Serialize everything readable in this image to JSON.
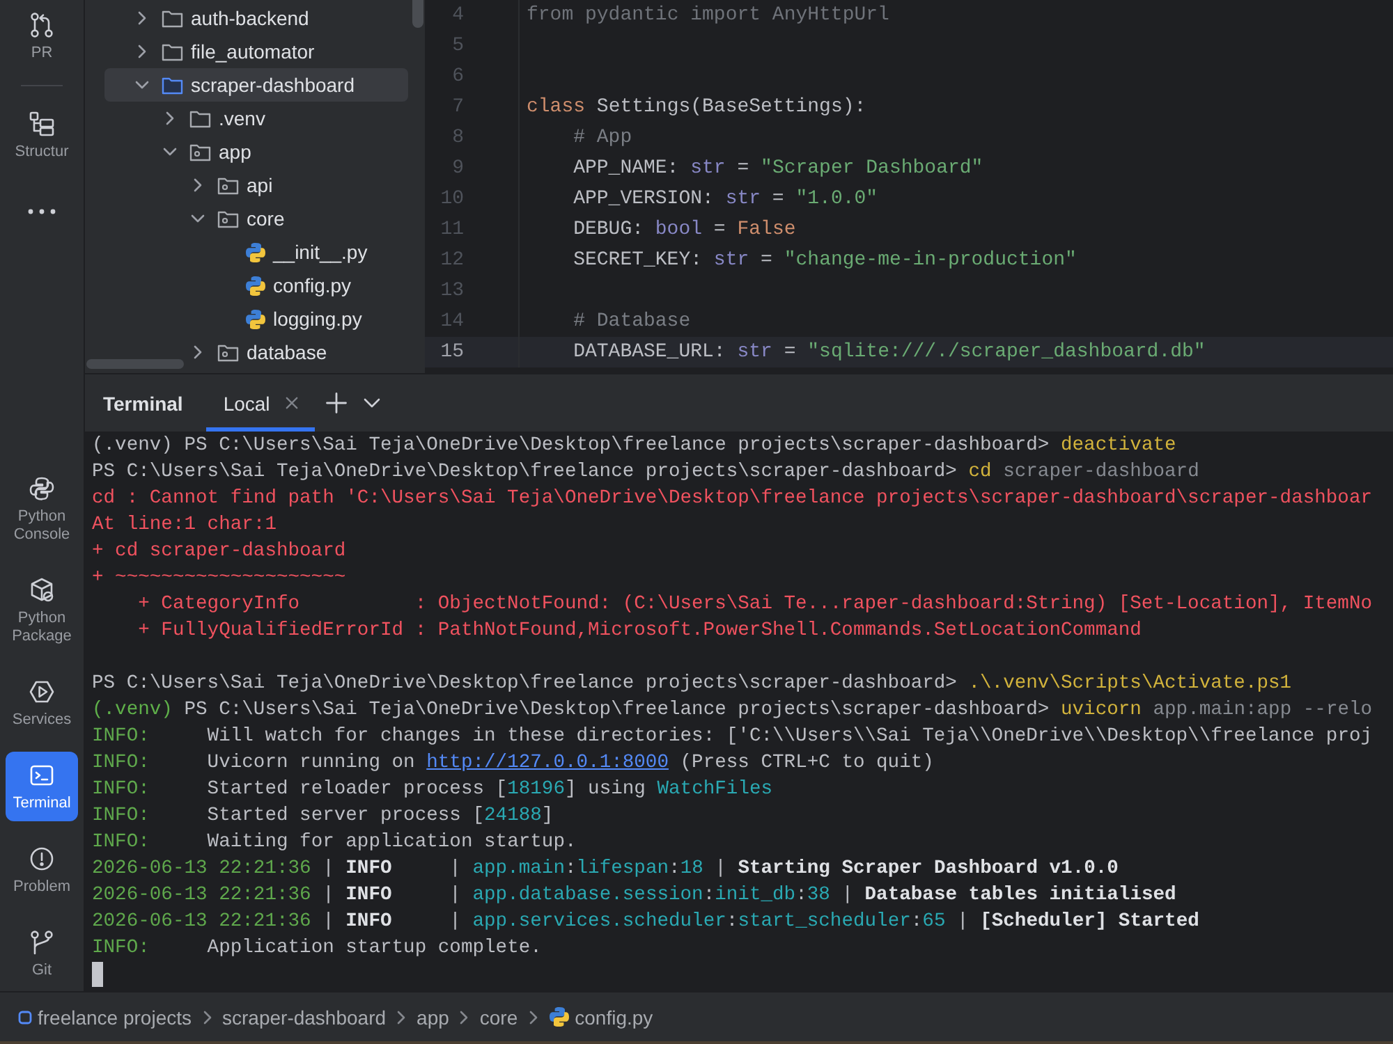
{
  "tool_strip": {
    "top": [
      {
        "kind": "pull-requests",
        "label": "PR",
        "selected": false
      },
      {
        "kind": "structure",
        "label": "Structur",
        "selected": false
      },
      {
        "kind": "more",
        "selected": false
      }
    ],
    "bottom": [
      {
        "kind": "python-console",
        "label": "Python Console",
        "selected": false
      },
      {
        "kind": "python-packages",
        "label": "Python Package",
        "selected": false
      },
      {
        "kind": "services",
        "label": "Services",
        "selected": false
      },
      {
        "kind": "terminal",
        "label": "Terminal",
        "selected": true
      },
      {
        "kind": "problems",
        "label": "Problem",
        "selected": false
      },
      {
        "kind": "git",
        "label": "Git",
        "selected": false
      }
    ]
  },
  "project_tree": {
    "items": [
      {
        "name": "auth-backend",
        "kind": "folder",
        "expanded": false,
        "selected": false
      },
      {
        "name": "file_automator",
        "kind": "folder",
        "expanded": false,
        "selected": false
      },
      {
        "name": "scraper-dashboard",
        "kind": "folder",
        "expanded": true,
        "selected": true,
        "children": [
          {
            "name": ".venv",
            "kind": "folder",
            "expanded": false,
            "selected": false
          },
          {
            "name": "app",
            "kind": "package",
            "expanded": true,
            "selected": false,
            "children": [
              {
                "name": "api",
                "kind": "package",
                "expanded": false,
                "selected": false
              },
              {
                "name": "core",
                "kind": "package",
                "expanded": true,
                "selected": false,
                "children": [
                  {
                    "name": "__init__.py",
                    "kind": "python-file",
                    "selected": false
                  },
                  {
                    "name": "config.py",
                    "kind": "python-file",
                    "selected": false
                  },
                  {
                    "name": "logging.py",
                    "kind": "python-file",
                    "selected": false
                  }
                ]
              },
              {
                "name": "database",
                "kind": "package",
                "expanded": false,
                "selected": false
              }
            ]
          }
        ]
      }
    ]
  },
  "editor": {
    "lines": [
      {
        "number": "4",
        "current": false,
        "tokens": [
          {
            "text": "from pydantic import AnyHttpUrl",
            "kind": "unused"
          }
        ]
      },
      {
        "number": "5",
        "current": false
      },
      {
        "number": "6",
        "current": false
      },
      {
        "number": "7",
        "current": false,
        "tokens": [
          {
            "text": "class",
            "kind": "keyword"
          },
          {
            "text": " Settings(BaseSettings):",
            "kind": "plain"
          }
        ],
        "children": [
          {
            "number": "8",
            "current": false,
            "tokens": [
              {
                "text": "# App",
                "kind": "comment"
              }
            ]
          },
          {
            "number": "9",
            "current": false,
            "tokens": [
              {
                "text": "APP_NAME: ",
                "kind": "plain"
              },
              {
                "text": "str",
                "kind": "builtin"
              },
              {
                "text": " = ",
                "kind": "plain"
              },
              {
                "text": "\"Scraper Dashboard\"",
                "kind": "string"
              }
            ]
          },
          {
            "number": "10",
            "current": false,
            "tokens": [
              {
                "text": "APP_VERSION: ",
                "kind": "plain"
              },
              {
                "text": "str",
                "kind": "builtin"
              },
              {
                "text": " = ",
                "kind": "plain"
              },
              {
                "text": "\"1.0.0\"",
                "kind": "string"
              }
            ]
          },
          {
            "number": "11",
            "current": false,
            "tokens": [
              {
                "text": "DEBUG: ",
                "kind": "plain"
              },
              {
                "text": "bool",
                "kind": "builtin"
              },
              {
                "text": " = ",
                "kind": "plain"
              },
              {
                "text": "False",
                "kind": "keyword"
              }
            ]
          },
          {
            "number": "12",
            "current": false,
            "tokens": [
              {
                "text": "SECRET_KEY: ",
                "kind": "plain"
              },
              {
                "text": "str",
                "kind": "builtin"
              },
              {
                "text": " = ",
                "kind": "plain"
              },
              {
                "text": "\"change-me-in-production\"",
                "kind": "string"
              }
            ]
          },
          {
            "number": "13",
            "current": false
          },
          {
            "number": "14",
            "current": false,
            "tokens": [
              {
                "text": "# Database",
                "kind": "comment"
              }
            ]
          },
          {
            "number": "15",
            "current": true,
            "tokens": [
              {
                "text": "DATABASE_URL: ",
                "kind": "plain"
              },
              {
                "text": "str",
                "kind": "builtin"
              },
              {
                "text": " = ",
                "kind": "plain"
              },
              {
                "text": "\"sqlite:///./scraper_dashboard.db\"",
                "kind": "string"
              }
            ]
          }
        ]
      }
    ]
  },
  "terminal": {
    "title": "Terminal",
    "tabs": [
      {
        "label": "Local",
        "selected": true
      }
    ],
    "cursor": true,
    "lines": [
      {
        "kind": "text",
        "segments": [
          {
            "text": "(.venv) PS C:\\Users\\Sai Teja\\OneDrive\\Desktop\\freelance projects\\scraper-dashboard> ",
            "kind": "plain"
          },
          {
            "text": "deactivate",
            "kind": "command"
          }
        ]
      },
      {
        "kind": "text",
        "segments": [
          {
            "text": "PS C:\\Users\\Sai Teja\\OneDrive\\Desktop\\freelance projects\\scraper-dashboard> ",
            "kind": "plain"
          },
          {
            "text": "cd",
            "kind": "command"
          },
          {
            "text": " scraper-dashboard",
            "kind": "arg"
          }
        ]
      },
      {
        "kind": "text",
        "segments": [
          {
            "text": "cd : Cannot find path 'C:\\Users\\Sai Teja\\OneDrive\\Desktop\\freelance projects\\scraper-dashboard\\scraper-dashboar",
            "kind": "error"
          }
        ]
      },
      {
        "kind": "text",
        "segments": [
          {
            "text": "At line:1 char:1",
            "kind": "error"
          }
        ]
      },
      {
        "kind": "text",
        "segments": [
          {
            "text": "+ cd scraper-dashboard",
            "kind": "error"
          }
        ]
      },
      {
        "kind": "text",
        "segments": [
          {
            "text": "+ ~~~~~~~~~~~~~~~~~~~~",
            "kind": "error"
          }
        ]
      },
      {
        "kind": "text",
        "segments": [
          {
            "text": "    + CategoryInfo          : ObjectNotFound: (C:\\Users\\Sai Te...raper-dashboard:String) [Set-Location], ItemNo",
            "kind": "error"
          }
        ]
      },
      {
        "kind": "text",
        "segments": [
          {
            "text": "    + FullyQualifiedErrorId : PathNotFound,Microsoft.PowerShell.Commands.SetLocationCommand",
            "kind": "error"
          }
        ]
      },
      {
        "kind": "blank"
      },
      {
        "kind": "text",
        "segments": [
          {
            "text": "PS C:\\Users\\Sai Teja\\OneDrive\\Desktop\\freelance projects\\scraper-dashboard> ",
            "kind": "plain"
          },
          {
            "text": ".\\.venv\\Scripts\\Activate.ps1",
            "kind": "command"
          }
        ]
      },
      {
        "kind": "text",
        "segments": [
          {
            "text": "(.venv)",
            "kind": "venv"
          },
          {
            "text": " PS C:\\Users\\Sai Teja\\OneDrive\\Desktop\\freelance projects\\scraper-dashboard> ",
            "kind": "plain"
          },
          {
            "text": "uvicorn",
            "kind": "command"
          },
          {
            "text": " app.main:app --relo",
            "kind": "arg"
          }
        ]
      },
      {
        "kind": "text",
        "segments": [
          {
            "text": "INFO:",
            "kind": "info"
          },
          {
            "text": "     Will watch for changes in these directories: ['C:\\\\Users\\\\Sai Teja\\\\OneDrive\\\\Desktop\\\\freelance proj",
            "kind": "plain"
          }
        ]
      },
      {
        "kind": "text",
        "segments": [
          {
            "text": "INFO:",
            "kind": "info"
          },
          {
            "text": "     Uvicorn running on ",
            "kind": "plain"
          },
          {
            "text": "http://127.0.0.1:8000",
            "kind": "link"
          },
          {
            "text": " (Press CTRL+C to quit)",
            "kind": "plain"
          }
        ]
      },
      {
        "kind": "text",
        "segments": [
          {
            "text": "INFO:",
            "kind": "info"
          },
          {
            "text": "     Started reloader process [",
            "kind": "plain"
          },
          {
            "text": "18196",
            "kind": "number"
          },
          {
            "text": "] using ",
            "kind": "plain"
          },
          {
            "text": "WatchFiles",
            "kind": "module"
          }
        ]
      },
      {
        "kind": "text",
        "segments": [
          {
            "text": "INFO:",
            "kind": "info"
          },
          {
            "text": "     Started server process [",
            "kind": "plain"
          },
          {
            "text": "24188",
            "kind": "number"
          },
          {
            "text": "]",
            "kind": "plain"
          }
        ]
      },
      {
        "kind": "text",
        "segments": [
          {
            "text": "INFO:",
            "kind": "info"
          },
          {
            "text": "     Waiting for application startup.",
            "kind": "plain"
          }
        ]
      },
      {
        "kind": "text",
        "segments": [
          {
            "text": "2026-06-13 22:21:36",
            "kind": "time"
          },
          {
            "text": " | ",
            "kind": "plain"
          },
          {
            "text": "INFO",
            "kind": "bold"
          },
          {
            "text": "     | ",
            "kind": "plain"
          },
          {
            "text": "app.main",
            "kind": "module"
          },
          {
            "text": ":",
            "kind": "plain"
          },
          {
            "text": "lifespan",
            "kind": "module"
          },
          {
            "text": ":",
            "kind": "plain"
          },
          {
            "text": "18",
            "kind": "module"
          },
          {
            "text": " | ",
            "kind": "plain"
          },
          {
            "text": "Starting Scraper Dashboard v1.0.0",
            "kind": "bold"
          }
        ]
      },
      {
        "kind": "text",
        "segments": [
          {
            "text": "2026-06-13 22:21:36",
            "kind": "time"
          },
          {
            "text": " | ",
            "kind": "plain"
          },
          {
            "text": "INFO",
            "kind": "bold"
          },
          {
            "text": "     | ",
            "kind": "plain"
          },
          {
            "text": "app.database.session",
            "kind": "module"
          },
          {
            "text": ":",
            "kind": "plain"
          },
          {
            "text": "init_db",
            "kind": "module"
          },
          {
            "text": ":",
            "kind": "plain"
          },
          {
            "text": "38",
            "kind": "module"
          },
          {
            "text": " | ",
            "kind": "plain"
          },
          {
            "text": "Database tables initialised",
            "kind": "bold"
          }
        ]
      },
      {
        "kind": "text",
        "segments": [
          {
            "text": "2026-06-13 22:21:36",
            "kind": "time"
          },
          {
            "text": " | ",
            "kind": "plain"
          },
          {
            "text": "INFO",
            "kind": "bold"
          },
          {
            "text": "     | ",
            "kind": "plain"
          },
          {
            "text": "app.services.scheduler",
            "kind": "module"
          },
          {
            "text": ":",
            "kind": "plain"
          },
          {
            "text": "start_scheduler",
            "kind": "module"
          },
          {
            "text": ":",
            "kind": "plain"
          },
          {
            "text": "65",
            "kind": "module"
          },
          {
            "text": " | ",
            "kind": "plain"
          },
          {
            "text": "[Scheduler] Started",
            "kind": "bold"
          }
        ]
      },
      {
        "kind": "text",
        "segments": [
          {
            "text": "INFO:",
            "kind": "info"
          },
          {
            "text": "     Application startup complete.",
            "kind": "plain"
          }
        ]
      }
    ]
  },
  "breadcrumbs": [
    {
      "label": "freelance projects",
      "kind": "module"
    },
    {
      "label": "scraper-dashboard",
      "kind": "folder"
    },
    {
      "label": "app",
      "kind": "folder"
    },
    {
      "label": "core",
      "kind": "folder"
    },
    {
      "label": "config.py",
      "kind": "python-file"
    }
  ]
}
